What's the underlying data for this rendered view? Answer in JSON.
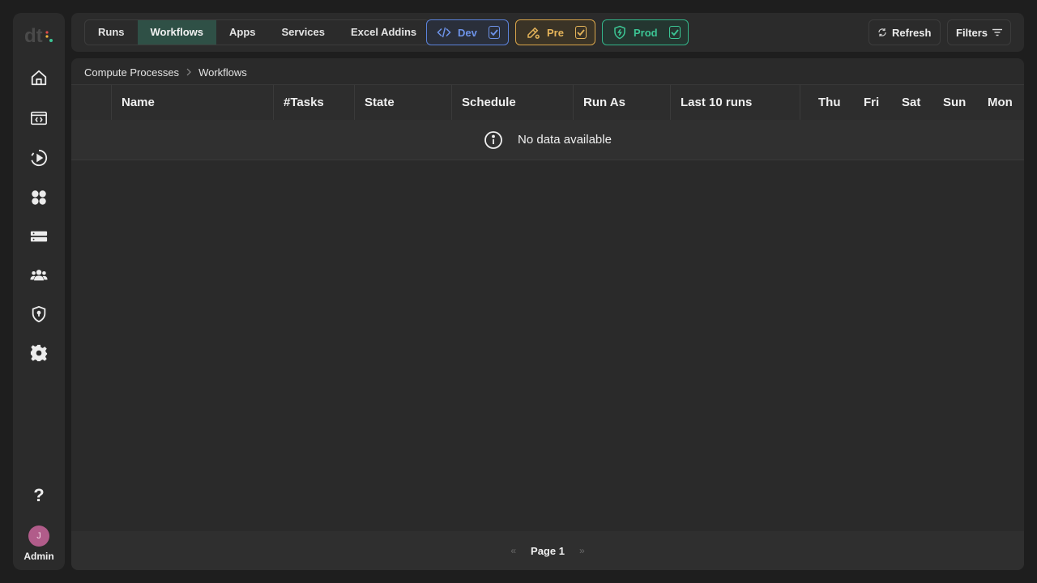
{
  "sidebar": {
    "logo": "dt.",
    "nav_icons": [
      "home-icon",
      "code-window-icon",
      "runs-icon",
      "apps-icon",
      "services-icon",
      "users-icon",
      "security-icon",
      "settings-icon"
    ],
    "help": "?",
    "avatar_initial": "J",
    "role": "Admin"
  },
  "topbar": {
    "tabs": [
      {
        "label": "Runs",
        "active": false
      },
      {
        "label": "Workflows",
        "active": true
      },
      {
        "label": "Apps",
        "active": false
      },
      {
        "label": "Services",
        "active": false
      },
      {
        "label": "Excel Addins",
        "active": false
      }
    ],
    "environments": [
      {
        "label": "Dev",
        "checked": true,
        "color": "#6d93e8"
      },
      {
        "label": "Pre",
        "checked": true,
        "color": "#e5b45a"
      },
      {
        "label": "Prod",
        "checked": true,
        "color": "#3cc695"
      }
    ],
    "refresh_label": "Refresh",
    "filters_label": "Filters"
  },
  "breadcrumb": [
    "Compute Processes",
    "Workflows"
  ],
  "table": {
    "columns": [
      "Name",
      "#Tasks",
      "State",
      "Schedule",
      "Run As",
      "Last 10 runs"
    ],
    "day_columns": [
      "Thu",
      "Fri",
      "Sat",
      "Sun",
      "Mon"
    ],
    "empty_message": "No data available"
  },
  "pagination": {
    "prev": "«",
    "label": "Page 1",
    "next": "»"
  },
  "colors": {
    "accent_active_tab": "#2f5046",
    "avatar": "#b15c8a"
  }
}
